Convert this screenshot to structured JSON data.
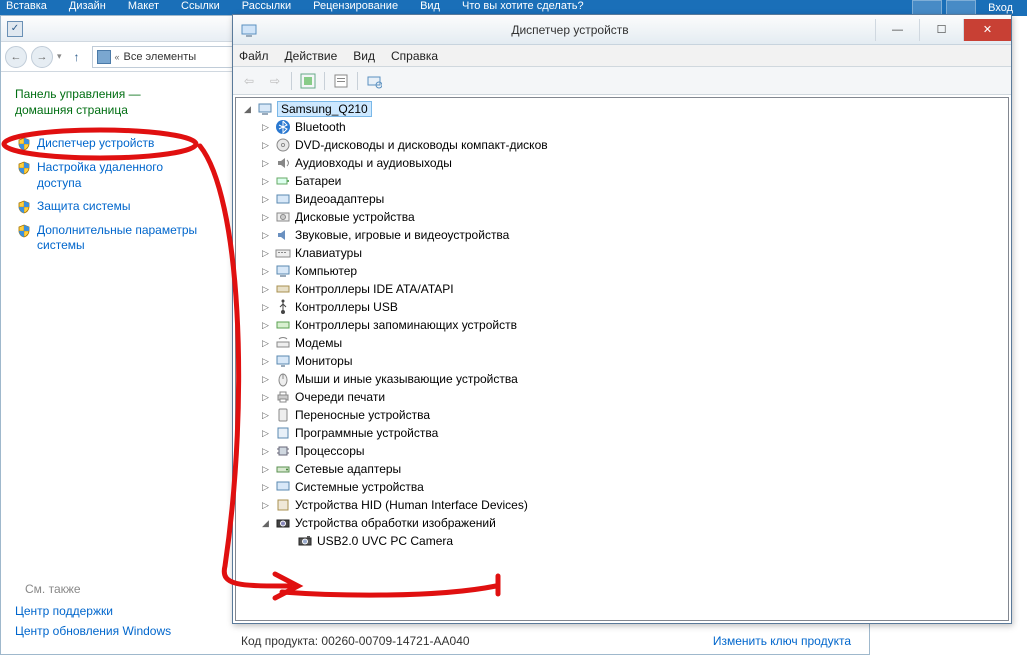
{
  "ribbon": {
    "tabs": [
      "Вставка",
      "Дизайн",
      "Макет",
      "Ссылки",
      "Рассылки",
      "Рецензирование",
      "Вид",
      "Что вы хотите сделать?"
    ],
    "login": "Вход"
  },
  "cp": {
    "sysicon_glyph": "✓",
    "path_prefix": "«",
    "path_text": "Все элементы",
    "home1": "Панель управления —",
    "home2": "домашняя страница",
    "links": [
      "Диспетчер устройств",
      "Настройка удаленного доступа",
      "Защита системы",
      "Дополнительные параметры системы"
    ],
    "seealso_hdr": "См. также",
    "seealso": [
      "Центр поддержки",
      "Центр обновления Windows"
    ],
    "product_label": "Код продукта:",
    "product_key": "00260-00709-14721-AA040",
    "change_key": "Изменить ключ продукта"
  },
  "dm": {
    "title": "Диспетчер устройств",
    "menu": [
      "Файл",
      "Действие",
      "Вид",
      "Справка"
    ],
    "root": "Samsung_Q210",
    "nodes": [
      {
        "icon": "bt",
        "label": "Bluetooth"
      },
      {
        "icon": "dvd",
        "label": "DVD-дисководы и дисководы компакт-дисков"
      },
      {
        "icon": "audio",
        "label": "Аудиовходы и аудиовыходы"
      },
      {
        "icon": "bat",
        "label": "Батареи"
      },
      {
        "icon": "vid",
        "label": "Видеоадаптеры"
      },
      {
        "icon": "disk",
        "label": "Дисковые устройства"
      },
      {
        "icon": "snd",
        "label": "Звуковые, игровые и видеоустройства"
      },
      {
        "icon": "kbd",
        "label": "Клавиатуры"
      },
      {
        "icon": "pc",
        "label": "Компьютер"
      },
      {
        "icon": "ide",
        "label": "Контроллеры IDE ATA/ATAPI"
      },
      {
        "icon": "usb",
        "label": "Контроллеры USB"
      },
      {
        "icon": "store",
        "label": "Контроллеры запоминающих устройств"
      },
      {
        "icon": "modem",
        "label": "Модемы"
      },
      {
        "icon": "mon",
        "label": "Мониторы"
      },
      {
        "icon": "mouse",
        "label": "Мыши и иные указывающие устройства"
      },
      {
        "icon": "print",
        "label": "Очереди печати"
      },
      {
        "icon": "port",
        "label": "Переносные устройства"
      },
      {
        "icon": "soft",
        "label": "Программные устройства"
      },
      {
        "icon": "cpu",
        "label": "Процессоры"
      },
      {
        "icon": "net",
        "label": "Сетевые адаптеры"
      },
      {
        "icon": "sys",
        "label": "Системные устройства"
      },
      {
        "icon": "hid",
        "label": "Устройства HID (Human Interface Devices)"
      },
      {
        "icon": "img",
        "label": "Устройства обработки изображений",
        "expanded": true,
        "children": [
          {
            "icon": "cam",
            "label": "USB2.0 UVC PC Camera"
          }
        ]
      }
    ]
  }
}
